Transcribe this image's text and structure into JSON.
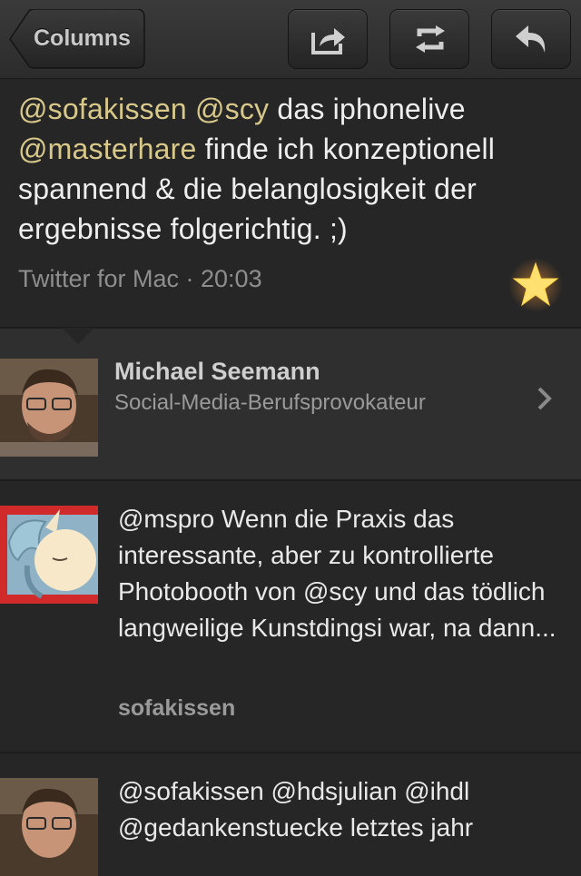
{
  "toolbar": {
    "back_label": "Columns",
    "actions": [
      "share-icon",
      "retweet-icon",
      "reply-icon"
    ]
  },
  "tweet": {
    "mention1": "@sofakissen",
    "mention2": "@scy",
    "text1": " das iphonelive ",
    "mention3": "@masterhare",
    "text2": " finde ich konzeptionell spannend & die belanglosigkeit der ergebnisse folgerichtig. ;)",
    "meta": "Twitter for Mac · 20:03",
    "favorited": true
  },
  "profile": {
    "name": "Michael Seemann",
    "bio": "Social-Media-Berufsprovokateur"
  },
  "timeline": [
    {
      "text": "@mspro Wenn die Praxis das interessante, aber zu kontrollierte Photobooth von @scy und das tödlich langweilige Kunstdingsi war, na dann...",
      "user": "sofakissen"
    },
    {
      "text": "@sofakissen @hdsjulian @ihdl @gedankenstuecke letztes jahr"
    }
  ],
  "colors": {
    "mention": "#d8c98a",
    "star": "#ffd84a",
    "background": "#262626"
  }
}
